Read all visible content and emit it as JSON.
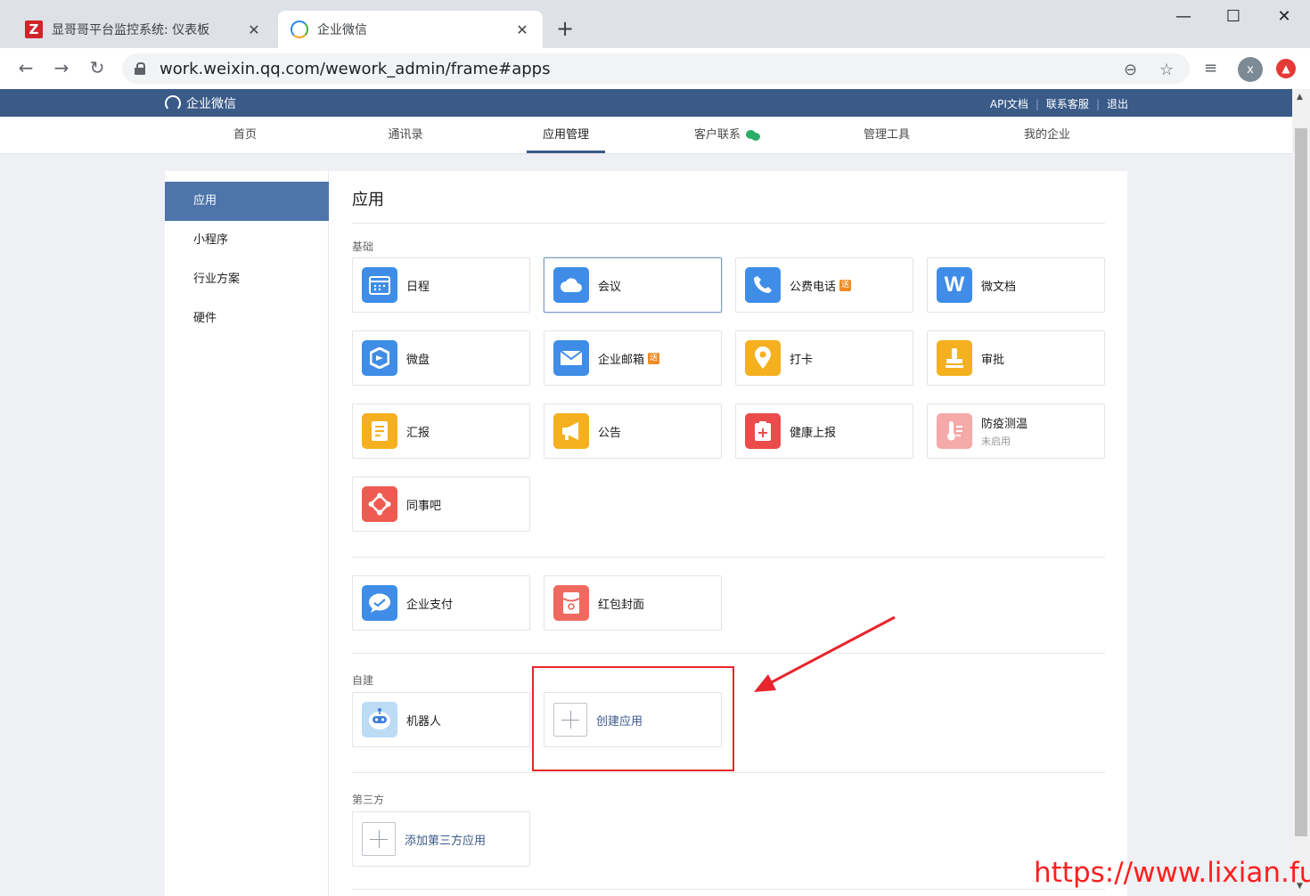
{
  "browser": {
    "tabs": [
      {
        "title": "显哥哥平台监控系统: 仪表板",
        "favicon": "Z"
      },
      {
        "title": "企业微信"
      }
    ],
    "url": "work.weixin.qq.com/wework_admin/frame#apps",
    "profile_initial": "x"
  },
  "header": {
    "brand": "企业微信",
    "links": [
      "API文档",
      "联系客服",
      "退出"
    ]
  },
  "nav": {
    "items": [
      "首页",
      "通讯录",
      "应用管理",
      "客户联系",
      "管理工具",
      "我的企业"
    ],
    "active": "应用管理"
  },
  "sidebar": {
    "items": [
      "应用",
      "小程序",
      "行业方案",
      "硬件"
    ],
    "active": "应用"
  },
  "main": {
    "title": "应用",
    "sections": {
      "basic": "基础",
      "custom": "自建",
      "third": "第三方"
    },
    "apps": {
      "schedule": "日程",
      "meeting": "会议",
      "phone": "公费电话",
      "doc": "微文档",
      "disk": "微盘",
      "mail": "企业邮箱",
      "checkin": "打卡",
      "approval": "审批",
      "report": "汇报",
      "notice": "公告",
      "health": "健康上报",
      "temperature": "防疫测温",
      "temperature_status": "未启用",
      "colleague": "同事吧",
      "pay": "企业支付",
      "redpacket": "红包封面",
      "robot": "机器人",
      "create": "创建应用",
      "add_third": "添加第三方应用"
    },
    "gift_badge": "送"
  },
  "watermark": "https://www.lixian.fun",
  "colors": {
    "topbar": "#3a5a88",
    "sidebar_active": "#4e75aa",
    "annotation": "#e8252c"
  }
}
